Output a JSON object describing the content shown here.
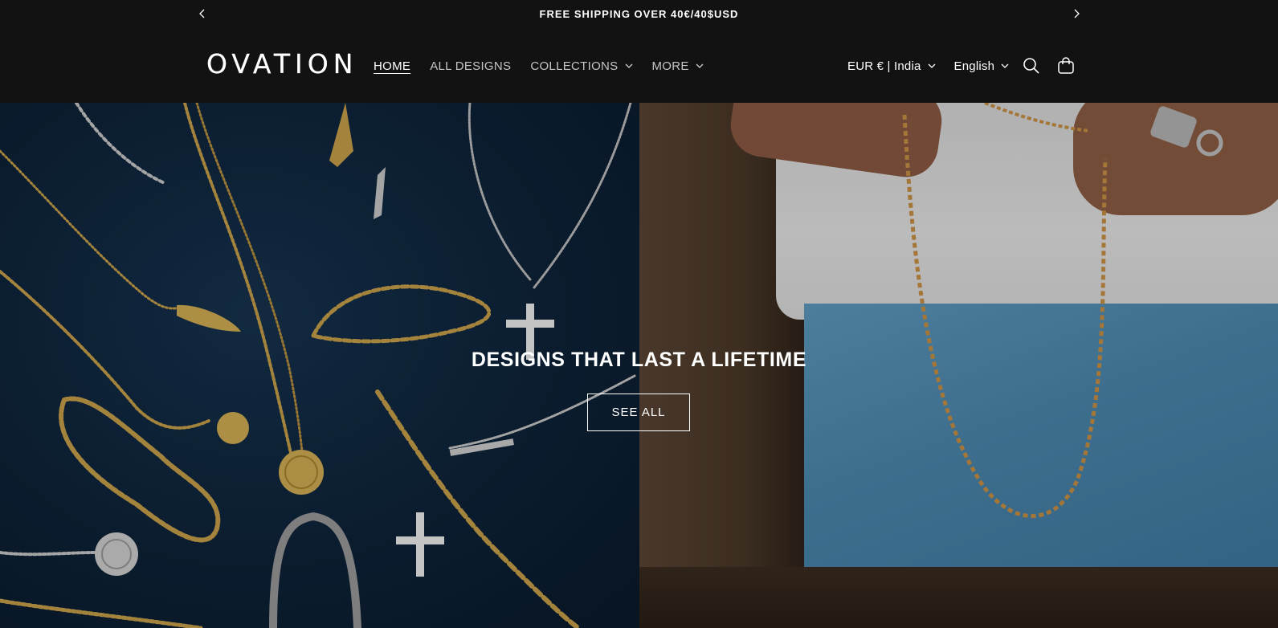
{
  "announcement": {
    "text": "FREE SHIPPING OVER 40€/40$USD",
    "prev_icon": "chevron-left-icon",
    "next_icon": "chevron-right-icon"
  },
  "header": {
    "logo": "OVATION",
    "nav": [
      {
        "label": "HOME",
        "active": true
      },
      {
        "label": "ALL DESIGNS"
      },
      {
        "label": "COLLECTIONS",
        "dropdown": true
      },
      {
        "label": "MORE",
        "dropdown": true
      }
    ],
    "currency": "EUR € | India",
    "language": "English",
    "search_icon": "search-icon",
    "cart_icon": "cart-icon"
  },
  "hero": {
    "title": "DESIGNS THAT LAST A LIFETIME",
    "button": "SEE ALL"
  },
  "colors": {
    "background": "#121212",
    "text": "#ffffff",
    "hero_left": "#0e2339",
    "gold": "#c9a24a",
    "silver": "#c8c8c8"
  }
}
